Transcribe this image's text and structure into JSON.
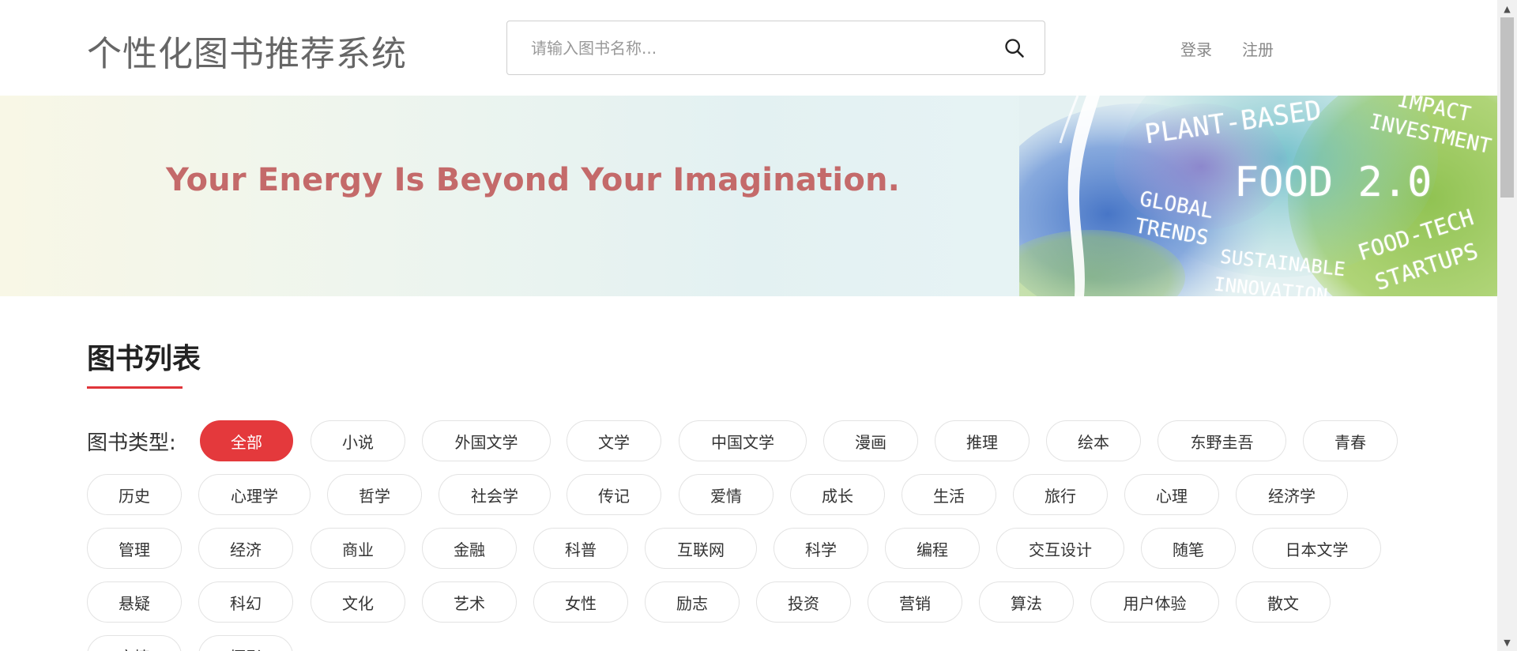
{
  "header": {
    "site_title": "个性化图书推荐系统",
    "search_placeholder": "请输入图书名称...",
    "login_label": "登录",
    "register_label": "注册"
  },
  "banner": {
    "slogan": "Your Energy Is Beyond Your Imagination.",
    "art_words": [
      "PLANT-BASED",
      "IMPACT",
      "INVESTMENT",
      "FOOD 2.0",
      "GLOBAL",
      "TRENDS",
      "SUSTAINABLE",
      "INNOVATION",
      "FOOD-TECH",
      "STARTUPS"
    ]
  },
  "section": {
    "title": "图书列表",
    "type_label": "图书类型:"
  },
  "categories": [
    "全部",
    "小说",
    "外国文学",
    "文学",
    "中国文学",
    "漫画",
    "推理",
    "绘本",
    "东野圭吾",
    "青春",
    "历史",
    "心理学",
    "哲学",
    "社会学",
    "传记",
    "爱情",
    "成长",
    "生活",
    "旅行",
    "心理",
    "经济学",
    "管理",
    "经济",
    "商业",
    "金融",
    "科普",
    "互联网",
    "科学",
    "编程",
    "交互设计",
    "随笔",
    "日本文学",
    "悬疑",
    "科幻",
    "文化",
    "艺术",
    "女性",
    "励志",
    "投资",
    "营销",
    "算法",
    "用户体验",
    "散文",
    "文情",
    "摄影"
  ],
  "active_category": "全部",
  "colors": {
    "accent": "#e4393c",
    "slogan": "#c46a6a",
    "title_gray": "#666666"
  },
  "icons": {
    "search": "search-icon",
    "scroll_up": "chevron-up-icon",
    "scroll_down": "chevron-down-icon"
  }
}
